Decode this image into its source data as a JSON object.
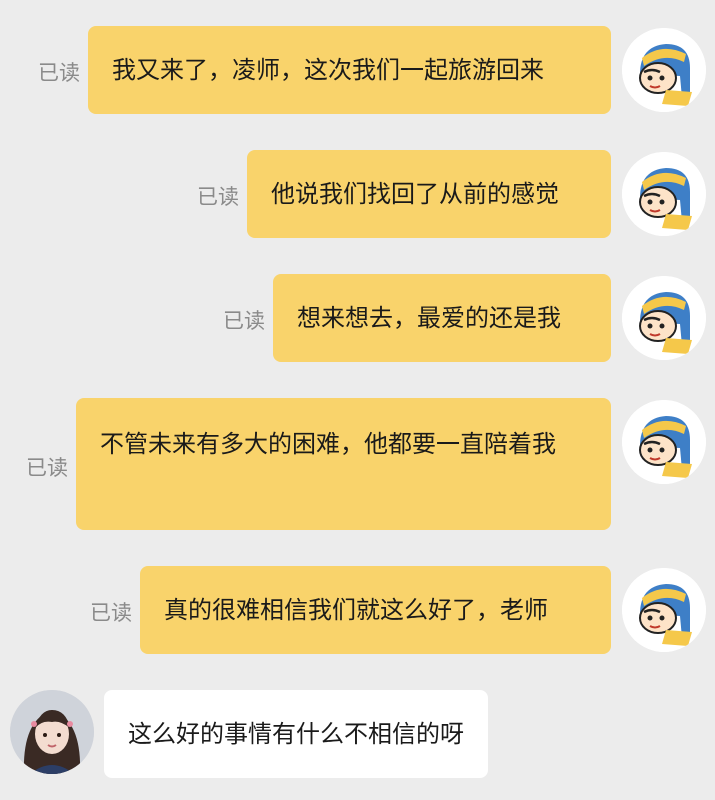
{
  "read_label": "已读",
  "messages_out": [
    {
      "text": "我又来了，凌师，这次我们一起旅游回来",
      "read": true
    },
    {
      "text": "他说我们找回了从前的感觉",
      "read": true
    },
    {
      "text": "想来想去，最爱的还是我",
      "read": true
    },
    {
      "text": "不管未来有多大的困难，他都要一直陪着我",
      "read": true
    },
    {
      "text": "真的很难相信我们就这么好了，老师",
      "read": true
    }
  ],
  "message_in": {
    "text": "这么好的事情有什么不相信的呀"
  },
  "colors": {
    "background": "#ececec",
    "bubble_out": "#f9d36b",
    "bubble_in": "#ffffff",
    "read_text": "#8a8a8a"
  },
  "icons": {
    "self_avatar": "cartoon-boy-headscarf-avatar",
    "other_avatar": "girl-photo-avatar"
  }
}
